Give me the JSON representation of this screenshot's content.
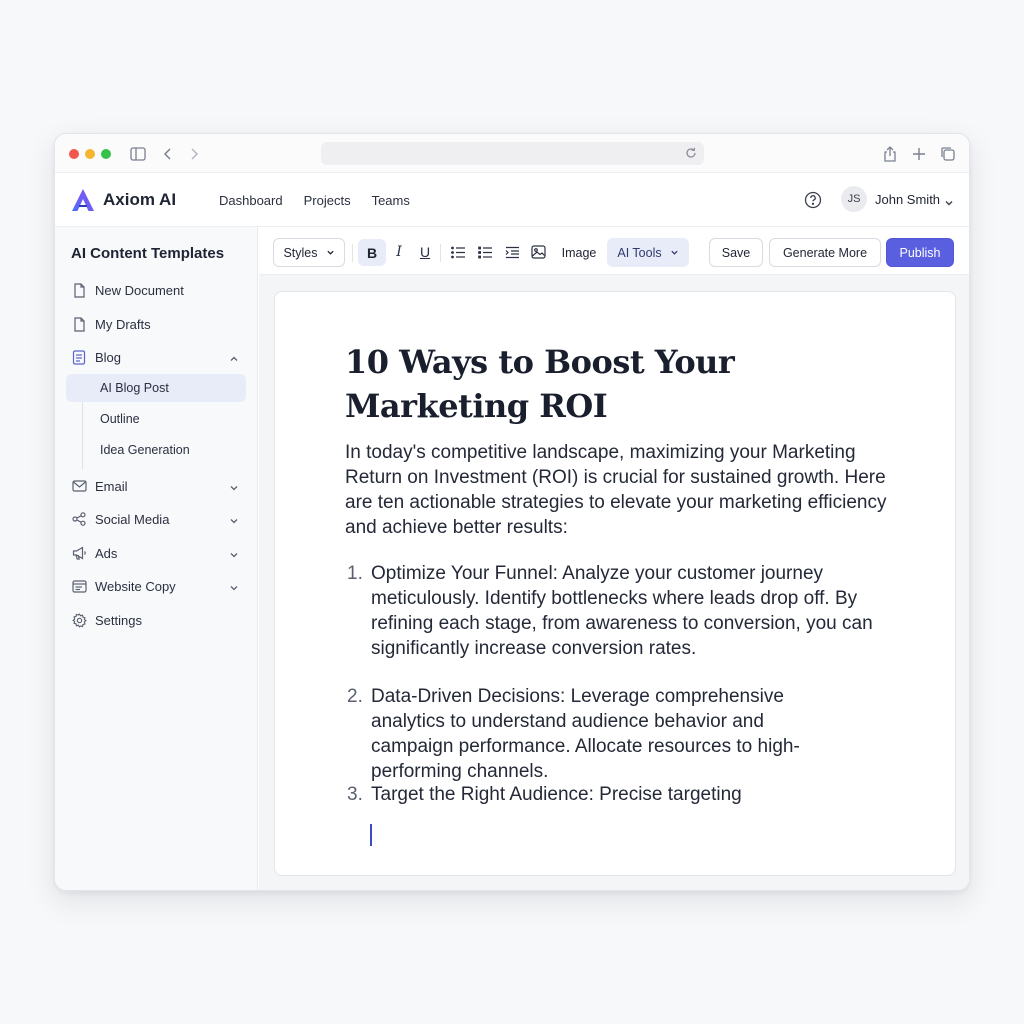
{
  "app": {
    "name": "Axiom AI",
    "colors": {
      "accent": "#5a5fe0",
      "brand_gradient": [
        "#4f6ef7",
        "#8a4ff0"
      ],
      "active_bg": "#e8ebf8"
    }
  },
  "header": {
    "nav": [
      "Dashboard",
      "Projects",
      "Teams"
    ],
    "user": {
      "initials": "JS",
      "name": "John Smith"
    }
  },
  "sidebar": {
    "title": "AI Content Templates",
    "items": [
      {
        "label": "New Document",
        "icon": "file-icon"
      },
      {
        "label": "My Drafts",
        "icon": "file-icon"
      },
      {
        "label": "Blog",
        "icon": "blog-icon",
        "expanded": true
      },
      {
        "label": "Email",
        "icon": "mail-icon"
      },
      {
        "label": "Social Media",
        "icon": "share-icon"
      },
      {
        "label": "Ads",
        "icon": "megaphone-icon"
      },
      {
        "label": "Website Copy",
        "icon": "browser-icon"
      },
      {
        "label": "Settings",
        "icon": "gear-icon"
      }
    ],
    "blog_sub": [
      "AI Blog Post",
      "Outline",
      "Idea Generation"
    ],
    "active_sub": "AI Blog Post"
  },
  "toolbar": {
    "styles": "Styles",
    "image": "Image",
    "ai_tools": "AI Tools",
    "save": "Save",
    "generate": "Generate More",
    "publish": "Publish"
  },
  "document": {
    "title": "10 Ways to Boost Your Marketing ROI",
    "intro": "In today's competitive landscape, maximizing your Marketing Return on Investment (ROI) is crucial for sustained growth. Here are ten actionable strategies to elevate your marketing efficiency and achieve better results:",
    "list": [
      {
        "num": "1.",
        "text": "Optimize Your Funnel: Analyze your customer journey meticulously. Identify bottlenecks where leads drop off. By refining each stage, from awareness to conversion, you can significantly increase conversion rates."
      },
      {
        "num": "2.",
        "text": "Data-Driven Decisions: Leverage comprehensive analytics to understand audience behavior and campaign performance. Allocate resources to high-performing channels."
      },
      {
        "num": "3.",
        "text": "Target the Right Audience: Precise targeting"
      }
    ]
  }
}
